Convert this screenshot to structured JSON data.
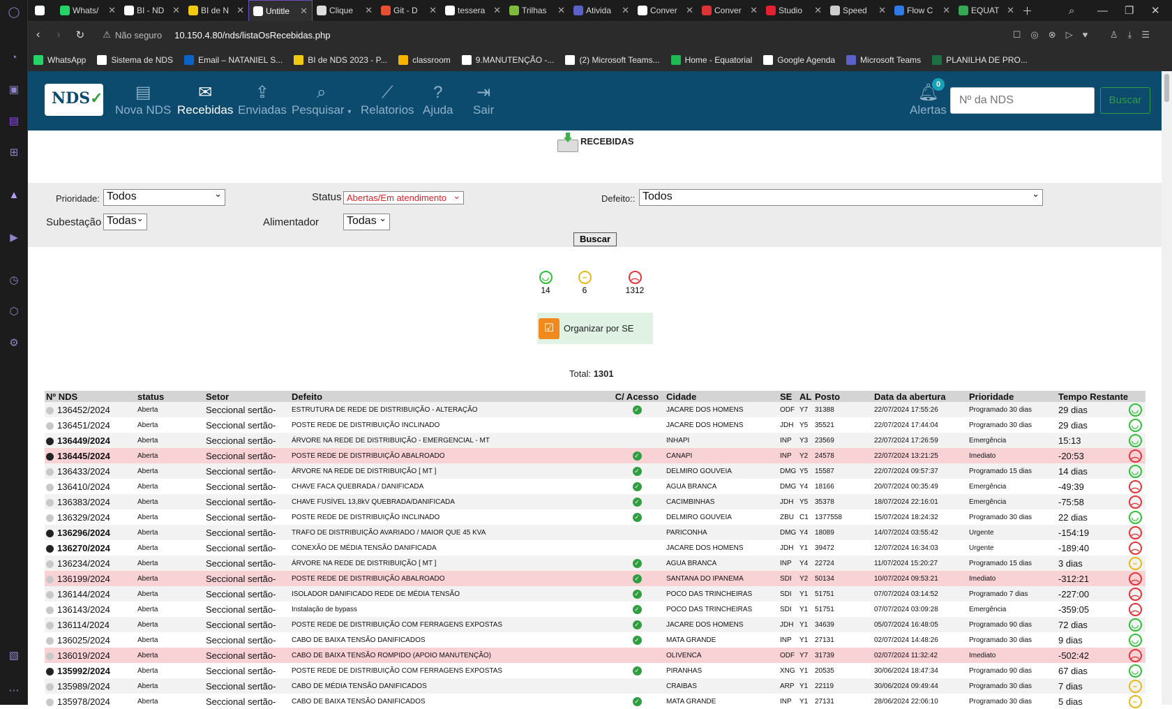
{
  "browser": {
    "tabs": [
      {
        "label": "",
        "color": "#ffffff"
      },
      {
        "label": "Whats/",
        "color": "#25d366"
      },
      {
        "label": "BI - ND",
        "color": "#ffffff"
      },
      {
        "label": "BI de N",
        "color": "#f2c811"
      },
      {
        "label": "Untitle",
        "color": "#ffffff",
        "active": true
      },
      {
        "label": "Clique",
        "color": "#dddddd"
      },
      {
        "label": "Git - D",
        "color": "#e84e31"
      },
      {
        "label": "tessera",
        "color": "#ffffff"
      },
      {
        "label": "Trilhas",
        "color": "#7dbb3c"
      },
      {
        "label": "Ativida",
        "color": "#5a62c8"
      },
      {
        "label": "Conver",
        "color": "#ffffff"
      },
      {
        "label": "Conver",
        "color": "#d33"
      },
      {
        "label": "Studio",
        "color": "#e52030"
      },
      {
        "label": "Speed",
        "color": "#cccccc"
      },
      {
        "label": "Flow C",
        "color": "#2f7ae5"
      },
      {
        "label": "EQUAT",
        "color": "#34a853"
      }
    ],
    "security": "Não seguro",
    "url": "10.150.4.80/nds/listaOsRecebidas.php",
    "bookmarks": [
      {
        "label": "WhatsApp",
        "color": "#25d366"
      },
      {
        "label": "Sistema de NDS",
        "color": "#ffffff"
      },
      {
        "label": "Email – NATANIEL S...",
        "color": "#0a64c8"
      },
      {
        "label": "BI de NDS 2023 - P...",
        "color": "#f2c811"
      },
      {
        "label": "classroom",
        "color": "#f5b400"
      },
      {
        "label": "9.MANUTENÇÃO -...",
        "color": "#ffffff"
      },
      {
        "label": "(2) Microsoft Teams...",
        "color": "#ffffff"
      },
      {
        "label": "Home - Equatorial",
        "color": "#1db954"
      },
      {
        "label": "Google Agenda",
        "color": "#ffffff"
      },
      {
        "label": "Microsoft Teams",
        "color": "#5a62c8"
      },
      {
        "label": "PLANILHA DE PRO...",
        "color": "#1d7044"
      }
    ]
  },
  "nav": {
    "logo": "NDS",
    "items": [
      "Nova NDS",
      "Recebidas",
      "Enviadas",
      "Pesquisar",
      "Relatorios",
      "Ajuda",
      "Sair"
    ],
    "alerts_label": "Alertas",
    "alerts_count": "0",
    "search_placeholder": "Nº da NDS",
    "search_button": "Buscar"
  },
  "page": {
    "title": "RECEBIDAS",
    "filters": {
      "prioridade_label": "Prioridade:",
      "prioridade_value": "Todos",
      "status_label": "Status",
      "status_value": "Abertas/Em atendimento",
      "defeito_label": "Defeito::",
      "defeito_value": "Todos",
      "subestacao_label": "Subestação",
      "subestacao_value": "Todas",
      "alimentador_label": "Alimentador",
      "alimentador_value": "Todas",
      "buscar": "Buscar"
    },
    "counts": {
      "green": "14",
      "yellow": "6",
      "red": "1312"
    },
    "organize_label": "Organizar por SE",
    "total_label": "Total:",
    "total_value": "1301"
  },
  "table": {
    "headers": [
      "Nº NDS",
      "status",
      "Setor",
      "Defeito",
      "C/ Acesso",
      "Cidade",
      "SE",
      "AL",
      "Posto",
      "Data da abertura",
      "Prioridade",
      "Tempo Restante"
    ],
    "rows": [
      {
        "nds": "136452/2024",
        "status": "Aberta",
        "setor": "Seccional sertão-",
        "defeito": "ESTRUTURA DE REDE DE DISTRIBUIÇÃO - ALTERAÇÃO",
        "acesso": true,
        "cidade": "JACARE DOS HOMENS",
        "se": "ODF",
        "al": "Y7",
        "posto": "31388",
        "data": "22/07/2024 17:55:26",
        "prioridade": "Programado 30 dias",
        "tempo": "29 dias",
        "face": "g",
        "bold": false,
        "style": "odd"
      },
      {
        "nds": "136451/2024",
        "status": "Aberta",
        "setor": "Seccional sertão-",
        "defeito": "POSTE REDE DE DISTRIBUIÇÃO INCLINADO",
        "acesso": false,
        "cidade": "JACARE DOS HOMENS",
        "se": "JDH",
        "al": "Y5",
        "posto": "35521",
        "data": "22/07/2024 17:44:04",
        "prioridade": "Programado 30 dias",
        "tempo": "29 dias",
        "face": "g",
        "bold": false,
        "style": "even"
      },
      {
        "nds": "136449/2024",
        "status": "Aberta",
        "setor": "Seccional sertão-",
        "defeito": "ÁRVORE NA REDE DE DISTRIBUIÇÃO - EMERGENCIAL - MT",
        "acesso": false,
        "cidade": "INHAPI",
        "se": "INP",
        "al": "Y3",
        "posto": "23569",
        "data": "22/07/2024 17:26:59",
        "prioridade": "Emergência",
        "tempo": "15:13",
        "face": "g",
        "bold": true,
        "style": "odd"
      },
      {
        "nds": "136445/2024",
        "status": "Aberta",
        "setor": "Seccional sertão-",
        "defeito": "POSTE REDE DE DISTRIBUIÇÃO ABALROADO",
        "acesso": true,
        "cidade": "CANAPI",
        "se": "INP",
        "al": "Y2",
        "posto": "24578",
        "data": "22/07/2024 13:21:25",
        "prioridade": "Imediato",
        "tempo": "-20:53",
        "face": "r",
        "bold": true,
        "style": "red"
      },
      {
        "nds": "136433/2024",
        "status": "Aberta",
        "setor": "Seccional sertão-",
        "defeito": "ÁRVORE NA REDE DE DISTRIBUIÇÃO [ MT ]",
        "acesso": true,
        "cidade": "DELMIRO GOUVEIA",
        "se": "DMG",
        "al": "Y5",
        "posto": "15587",
        "data": "22/07/2024 09:57:37",
        "prioridade": "Programado 15 dias",
        "tempo": "14 dias",
        "face": "g",
        "bold": false,
        "style": "odd"
      },
      {
        "nds": "136410/2024",
        "status": "Aberta",
        "setor": "Seccional sertão-",
        "defeito": "CHAVE FACA QUEBRADA / DANIFICADA",
        "acesso": true,
        "cidade": "AGUA BRANCA",
        "se": "DMG",
        "al": "Y4",
        "posto": "18166",
        "data": "20/07/2024 00:35:49",
        "prioridade": "Emergência",
        "tempo": "-49:39",
        "face": "r",
        "bold": false,
        "style": "even"
      },
      {
        "nds": "136383/2024",
        "status": "Aberta",
        "setor": "Seccional sertão-",
        "defeito": "CHAVE FUSÍVEL 13,8kV QUEBRADA/DANIFICADA",
        "acesso": true,
        "cidade": "CACIMBINHAS",
        "se": "JDH",
        "al": "Y5",
        "posto": "35378",
        "data": "18/07/2024 22:16:01",
        "prioridade": "Emergência",
        "tempo": "-75:58",
        "face": "r",
        "bold": false,
        "style": "odd"
      },
      {
        "nds": "136329/2024",
        "status": "Aberta",
        "setor": "Seccional sertão-",
        "defeito": "POSTE REDE DE DISTRIBUIÇÃO INCLINADO",
        "acesso": true,
        "cidade": "DELMIRO GOUVEIA",
        "se": "ZBU",
        "al": "C1",
        "posto": "1377558",
        "data": "15/07/2024 18:24:32",
        "prioridade": "Programado 30 dias",
        "tempo": "22 dias",
        "face": "g",
        "bold": false,
        "style": "even"
      },
      {
        "nds": "136296/2024",
        "status": "Aberta",
        "setor": "Seccional sertão-",
        "defeito": "TRAFO DE DISTRIBUIÇÃO AVARIADO / MAIOR QUE 45 KVA",
        "acesso": false,
        "cidade": "PARICONHA",
        "se": "DMG",
        "al": "Y4",
        "posto": "18089",
        "data": "14/07/2024 03:55:42",
        "prioridade": "Urgente",
        "tempo": "-154:19",
        "face": "r",
        "bold": true,
        "style": "odd"
      },
      {
        "nds": "136270/2024",
        "status": "Aberta",
        "setor": "Seccional sertão-",
        "defeito": "CONEXÃO DE MÉDIA TENSÃO DANIFICADA",
        "acesso": false,
        "cidade": "JACARE DOS HOMENS",
        "se": "JDH",
        "al": "Y1",
        "posto": "39472",
        "data": "12/07/2024 16:34:03",
        "prioridade": "Urgente",
        "tempo": "-189:40",
        "face": "r",
        "bold": true,
        "style": "even"
      },
      {
        "nds": "136234/2024",
        "status": "Aberta",
        "setor": "Seccional sertão-",
        "defeito": "ÁRVORE NA REDE DE DISTRIBUIÇÃO [ MT ]",
        "acesso": true,
        "cidade": "AGUA BRANCA",
        "se": "INP",
        "al": "Y4",
        "posto": "22724",
        "data": "11/07/2024 15:20:27",
        "prioridade": "Programado 15 dias",
        "tempo": "3 dias",
        "face": "y",
        "bold": false,
        "style": "odd"
      },
      {
        "nds": "136199/2024",
        "status": "Aberta",
        "setor": "Seccional sertão-",
        "defeito": "POSTE REDE DE DISTRIBUIÇÃO ABALROADO",
        "acesso": true,
        "cidade": "SANTANA DO IPANEMA",
        "se": "SDI",
        "al": "Y2",
        "posto": "50134",
        "data": "10/07/2024 09:53:21",
        "prioridade": "Imediato",
        "tempo": "-312:21",
        "face": "r",
        "bold": false,
        "style": "red"
      },
      {
        "nds": "136144/2024",
        "status": "Aberta",
        "setor": "Seccional sertão-",
        "defeito": "ISOLADOR DANIFICADO REDE DE MÉDIA TENSÃO",
        "acesso": true,
        "cidade": "POCO DAS TRINCHEIRAS",
        "se": "SDI",
        "al": "Y1",
        "posto": "51751",
        "data": "07/07/2024 03:14:52",
        "prioridade": "Programado 7 dias",
        "tempo": "-227:00",
        "face": "r",
        "bold": false,
        "style": "odd"
      },
      {
        "nds": "136143/2024",
        "status": "Aberta",
        "setor": "Seccional sertão-",
        "defeito": "Instalação de bypass",
        "acesso": true,
        "cidade": "POCO DAS TRINCHEIRAS",
        "se": "SDI",
        "al": "Y1",
        "posto": "51751",
        "data": "07/07/2024 03:09:28",
        "prioridade": "Emergência",
        "tempo": "-359:05",
        "face": "r",
        "bold": false,
        "style": "even"
      },
      {
        "nds": "136114/2024",
        "status": "Aberta",
        "setor": "Seccional sertão-",
        "defeito": "POSTE REDE DE DISTRIBUIÇÃO COM FERRAGENS EXPOSTAS",
        "acesso": true,
        "cidade": "JACARE DOS HOMENS",
        "se": "JDH",
        "al": "Y1",
        "posto": "34639",
        "data": "05/07/2024 16:48:05",
        "prioridade": "Programado 90 dias",
        "tempo": "72 dias",
        "face": "g",
        "bold": false,
        "style": "odd"
      },
      {
        "nds": "136025/2024",
        "status": "Aberta",
        "setor": "Seccional sertão-",
        "defeito": "CABO DE BAIXA TENSÃO DANIFICADOS",
        "acesso": true,
        "cidade": "MATA GRANDE",
        "se": "INP",
        "al": "Y1",
        "posto": "27131",
        "data": "02/07/2024 14:48:26",
        "prioridade": "Programado 30 dias",
        "tempo": "9 dias",
        "face": "g",
        "bold": false,
        "style": "even"
      },
      {
        "nds": "136019/2024",
        "status": "Aberta",
        "setor": "Seccional sertão-",
        "defeito": "CABO DE BAIXA TENSÃO ROMPIDO (APOIO MANUTENÇÃO)",
        "acesso": false,
        "cidade": "OLIVENCA",
        "se": "ODF",
        "al": "Y7",
        "posto": "31739",
        "data": "02/07/2024 11:32:42",
        "prioridade": "Imediato",
        "tempo": "-502:42",
        "face": "r",
        "bold": false,
        "style": "red"
      },
      {
        "nds": "135992/2024",
        "status": "Aberta",
        "setor": "Seccional sertão-",
        "defeito": "POSTE REDE DE DISTRIBUIÇÃO COM FERRAGENS EXPOSTAS",
        "acesso": true,
        "cidade": "PIRANHAS",
        "se": "XNG",
        "al": "Y1",
        "posto": "20535",
        "data": "30/06/2024 18:47:34",
        "prioridade": "Programado 90 dias",
        "tempo": "67 dias",
        "face": "g",
        "bold": true,
        "style": "even"
      },
      {
        "nds": "135989/2024",
        "status": "Aberta",
        "setor": "Seccional sertão-",
        "defeito": "CABO DE MÉDIA TENSÃO DANIFICADOS",
        "acesso": false,
        "cidade": "CRAIBAS",
        "se": "ARP",
        "al": "Y1",
        "posto": "22119",
        "data": "30/06/2024 09:49:44",
        "prioridade": "Programado 30 dias",
        "tempo": "7 dias",
        "face": "y",
        "bold": false,
        "style": "odd"
      },
      {
        "nds": "135978/2024",
        "status": "Aberta",
        "setor": "Seccional sertão-",
        "defeito": "CABO DE BAIXA TENSÃO DANIFICADOS",
        "acesso": true,
        "cidade": "MATA GRANDE",
        "se": "INP",
        "al": "Y1",
        "posto": "27131",
        "data": "28/06/2024 22:06:10",
        "prioridade": "Programado 30 dias",
        "tempo": "5 dias",
        "face": "y",
        "bold": false,
        "style": "even"
      }
    ]
  }
}
